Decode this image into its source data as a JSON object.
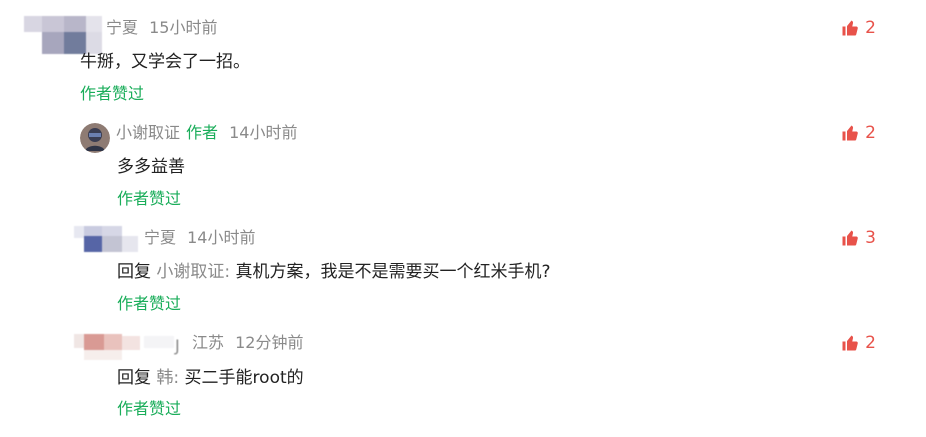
{
  "colors": {
    "author_green": "#1aad5a",
    "like_red": "#e8524a",
    "meta_gray": "#8a8a8a"
  },
  "comments": [
    {
      "user": "宁夏",
      "time": "15小时前",
      "text": "牛掰，又学会了一招。",
      "liked_by_author": "作者赞过",
      "likes": "2",
      "avatar_icon": "pixelated-avatar"
    },
    {
      "user": "小谢取证",
      "author_tag": "作者",
      "time": "14小时前",
      "text": "多多益善",
      "liked_by_author": "作者赞过",
      "likes": "2",
      "avatar_icon": "photo-avatar"
    },
    {
      "user": "宁夏",
      "time": "14小时前",
      "reply_prefix": "回复",
      "reply_target": "小谢取证:",
      "text": "真机方案，我是不是需要买一个红米手机?",
      "liked_by_author": "作者赞过",
      "likes": "3",
      "avatar_icon": "pixelated-avatar"
    },
    {
      "user": "江苏",
      "time": "12分钟前",
      "reply_prefix": "回复",
      "reply_target": "韩:",
      "text": "买二手能root的",
      "liked_by_author": "作者赞过",
      "likes": "2",
      "avatar_icon": "pixelated-avatar"
    }
  ]
}
